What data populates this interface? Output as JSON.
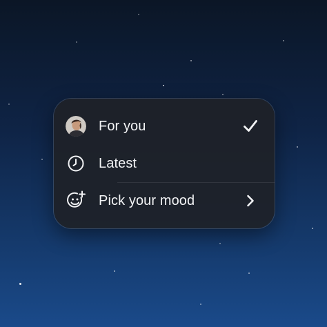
{
  "menu": {
    "items": [
      {
        "label": "For you",
        "leading_icon": "avatar",
        "trailing_icon": "checkmark-icon",
        "selected": true
      },
      {
        "label": "Latest",
        "leading_icon": "clock-icon",
        "trailing_icon": ""
      },
      {
        "label": "Pick your mood",
        "leading_icon": "smiley-plus-icon",
        "trailing_icon": "chevron-right-icon"
      }
    ]
  },
  "colors": {
    "background_top": "#0b1626",
    "background_bottom": "#1a4a8a",
    "menu_background": "#1e2128",
    "text": "#f2f3f5"
  }
}
